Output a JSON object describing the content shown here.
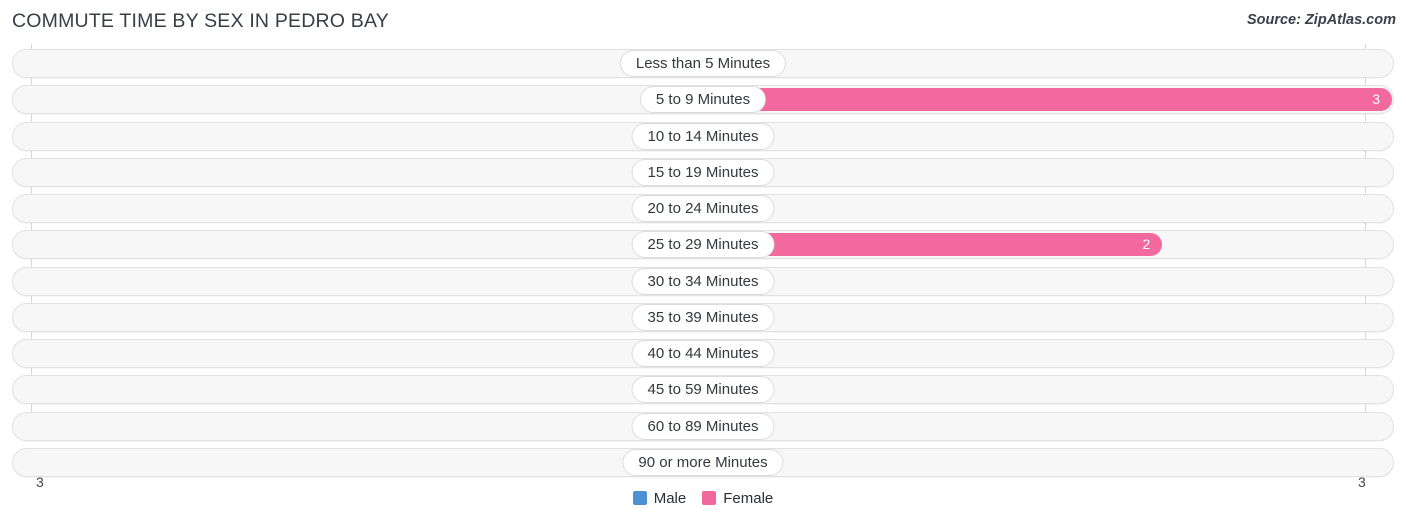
{
  "header": {
    "title": "COMMUTE TIME BY SEX IN PEDRO BAY",
    "source": "Source: ZipAtlas.com"
  },
  "legend": {
    "male_label": "Male",
    "female_label": "Female",
    "male_color": "#4d90d6",
    "female_color": "#f2689c"
  },
  "axis": {
    "left_tick": "3",
    "right_tick": "3",
    "max": 3
  },
  "colors": {
    "male_bar": "#a9c9ee",
    "female_bar": "#f9a8c4",
    "female_bar_value": "#f2699d",
    "track": "#f7f7f7",
    "gridline": "#d8d8d8"
  },
  "chart_data": {
    "type": "bar",
    "title": "COMMUTE TIME BY SEX IN PEDRO BAY",
    "subtitle": "Source: ZipAtlas.com",
    "orientation": "horizontal-diverging",
    "xlabel": "",
    "ylabel": "",
    "xlim": [
      3,
      3
    ],
    "grid": true,
    "legend_position": "bottom-center",
    "categories": [
      "Less than 5 Minutes",
      "5 to 9 Minutes",
      "10 to 14 Minutes",
      "15 to 19 Minutes",
      "20 to 24 Minutes",
      "25 to 29 Minutes",
      "30 to 34 Minutes",
      "35 to 39 Minutes",
      "40 to 44 Minutes",
      "45 to 59 Minutes",
      "60 to 89 Minutes",
      "90 or more Minutes"
    ],
    "series": [
      {
        "name": "Male",
        "values": [
          0,
          0,
          0,
          0,
          0,
          0,
          0,
          0,
          0,
          0,
          0,
          0
        ]
      },
      {
        "name": "Female",
        "values": [
          0,
          3,
          0,
          0,
          0,
          2,
          0,
          0,
          0,
          0,
          0,
          0
        ]
      }
    ]
  }
}
